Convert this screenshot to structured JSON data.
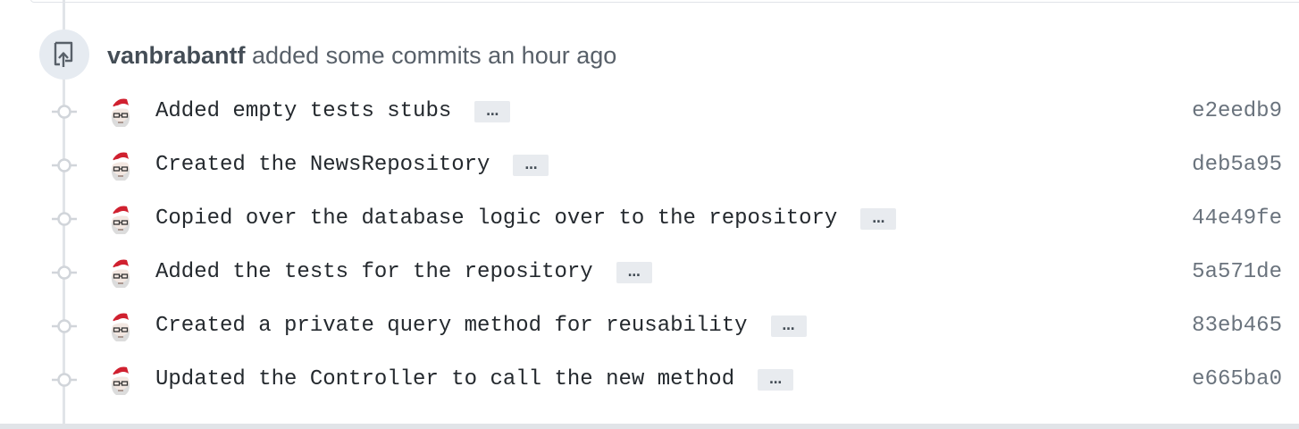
{
  "event": {
    "icon": "repo-push-icon",
    "author": "vanbrabantf",
    "action_text": " added some commits an hour ago"
  },
  "commits": [
    {
      "message": "Added empty tests stubs",
      "ellipsis": "…",
      "sha": "e2eedb9"
    },
    {
      "message": "Created the NewsRepository",
      "ellipsis": "…",
      "sha": "deb5a95"
    },
    {
      "message": "Copied over the database logic over to the repository",
      "ellipsis": "…",
      "sha": "44e49fe"
    },
    {
      "message": "Added the tests for the repository",
      "ellipsis": "…",
      "sha": "5a571de"
    },
    {
      "message": "Created a private query method for reusability",
      "ellipsis": "…",
      "sha": "83eb465"
    },
    {
      "message": "Updated the Controller to call the new method",
      "ellipsis": "…",
      "sha": "e665ba0"
    }
  ],
  "colors": {
    "timeline": "#e1e4e8",
    "badge_bg": "#e6ebf1",
    "sha_text": "#6a737d",
    "ellipsis_bg": "#e8ebef"
  }
}
